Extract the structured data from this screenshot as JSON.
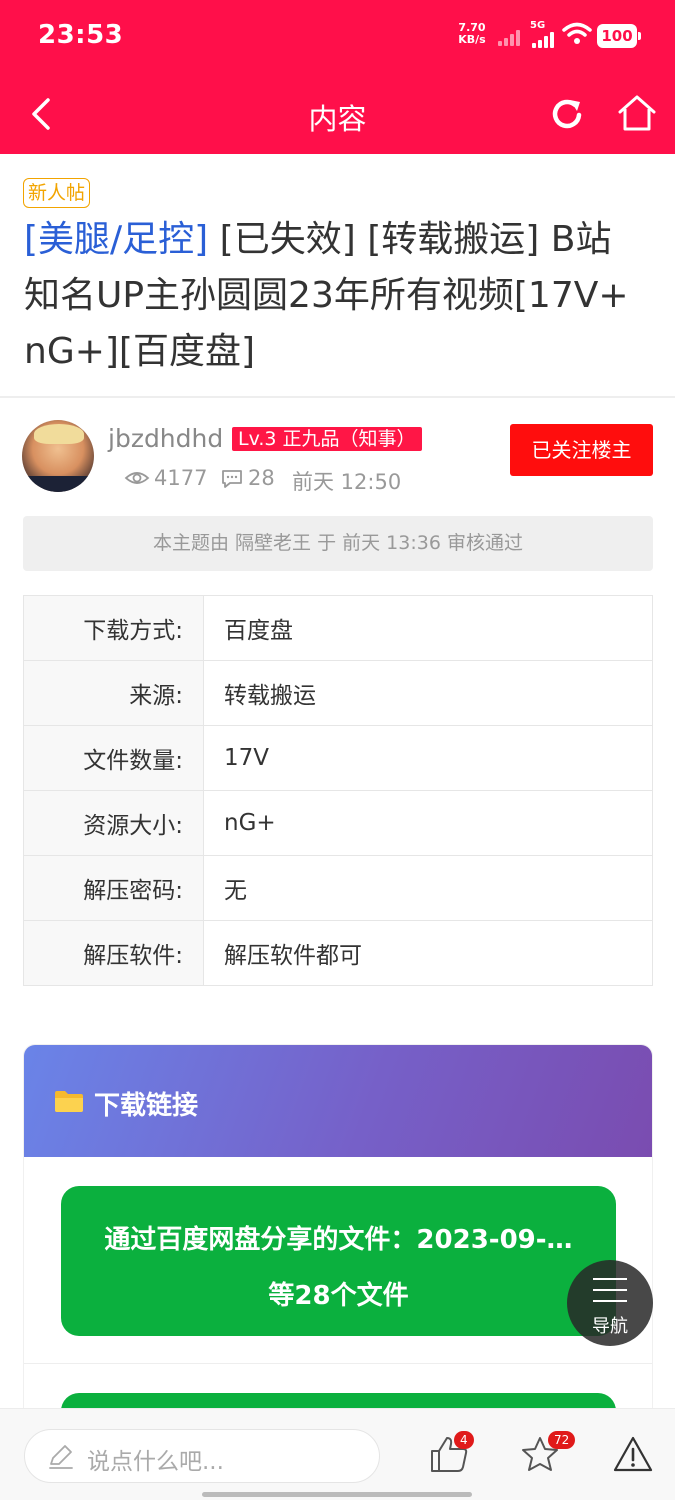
{
  "status_bar": {
    "time": "23:53",
    "net_speed_value": "7.70",
    "net_speed_unit": "KB/s",
    "network": "5G",
    "battery": "100"
  },
  "header": {
    "title": "内容"
  },
  "post": {
    "new_tag": "新人帖",
    "category": "[美腿/足控]",
    "title_rest": " [已失效] [转载搬运] B站知名UP主孙圆圆23年所有视频[17V+nG+][百度盘]"
  },
  "author": {
    "name": "jbzdhdhd",
    "level": "Lv.3 正九品（知事）",
    "follow_label": "已关注楼主",
    "views": "4177",
    "comments": "28",
    "time": "前天 12:50"
  },
  "audit_notice": "本主题由 隔壁老王 于 前天 13:36 审核通过",
  "info_rows": [
    {
      "key": "下载方式:",
      "value": "百度盘"
    },
    {
      "key": "来源:",
      "value": "转载搬运"
    },
    {
      "key": "文件数量:",
      "value": "17V"
    },
    {
      "key": "资源大小:",
      "value": "nG+"
    },
    {
      "key": "解压密码:",
      "value": "无"
    },
    {
      "key": "解压软件:",
      "value": "解压软件都可"
    }
  ],
  "download": {
    "header": "下载链接",
    "link1_line1": "通过百度网盘分享的文件：2023-09-…",
    "link1_line2": "等28个文件"
  },
  "float_nav": {
    "label": "导航"
  },
  "bottom_bar": {
    "comment_placeholder": "说点什么吧...",
    "like_count": "4",
    "favorite_count": "72"
  },
  "colors": {
    "brand": "#ff0f4a",
    "category_link": "#2a5fd6",
    "download_button": "#0bb03e",
    "new_tag": "#f2a400"
  }
}
